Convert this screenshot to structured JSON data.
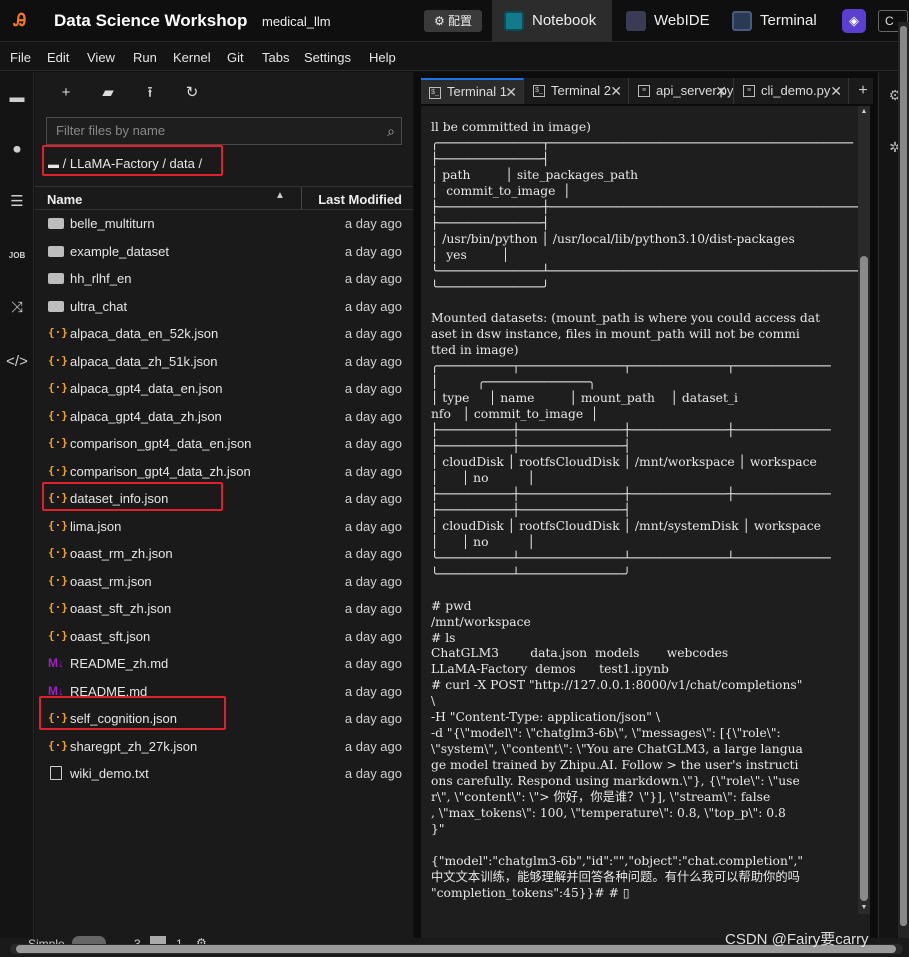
{
  "topbar": {
    "app_title": "Data Science Workshop",
    "project": "medical_llm",
    "config_label": "配置",
    "tabs": [
      {
        "label": "Notebook"
      },
      {
        "label": "WebIDE"
      },
      {
        "label": "Terminal"
      }
    ],
    "cut_label": "C"
  },
  "menu": [
    "File",
    "Edit",
    "View",
    "Run",
    "Kernel",
    "Git",
    "Tabs",
    "Settings",
    "Help"
  ],
  "filebrowser": {
    "filter_placeholder": "Filter files by name",
    "breadcrumb": "/ LLaMA-Factory / data /",
    "col_name": "Name",
    "col_modified": "Last Modified",
    "files": [
      {
        "name": "belle_multiturn",
        "type": "folder",
        "modified": "a day ago"
      },
      {
        "name": "example_dataset",
        "type": "folder",
        "modified": "a day ago"
      },
      {
        "name": "hh_rlhf_en",
        "type": "folder",
        "modified": "a day ago"
      },
      {
        "name": "ultra_chat",
        "type": "folder",
        "modified": "a day ago"
      },
      {
        "name": "alpaca_data_en_52k.json",
        "type": "json",
        "modified": "a day ago"
      },
      {
        "name": "alpaca_data_zh_51k.json",
        "type": "json",
        "modified": "a day ago"
      },
      {
        "name": "alpaca_gpt4_data_en.json",
        "type": "json",
        "modified": "a day ago"
      },
      {
        "name": "alpaca_gpt4_data_zh.json",
        "type": "json",
        "modified": "a day ago"
      },
      {
        "name": "comparison_gpt4_data_en.json",
        "type": "json",
        "modified": "a day ago"
      },
      {
        "name": "comparison_gpt4_data_zh.json",
        "type": "json",
        "modified": "a day ago"
      },
      {
        "name": "dataset_info.json",
        "type": "json",
        "modified": "a day ago"
      },
      {
        "name": "lima.json",
        "type": "json",
        "modified": "a day ago"
      },
      {
        "name": "oaast_rm_zh.json",
        "type": "json",
        "modified": "a day ago"
      },
      {
        "name": "oaast_rm.json",
        "type": "json",
        "modified": "a day ago"
      },
      {
        "name": "oaast_sft_zh.json",
        "type": "json",
        "modified": "a day ago"
      },
      {
        "name": "oaast_sft.json",
        "type": "json",
        "modified": "a day ago"
      },
      {
        "name": "README_zh.md",
        "type": "md",
        "modified": "a day ago"
      },
      {
        "name": "README.md",
        "type": "md",
        "modified": "a day ago"
      },
      {
        "name": "self_cognition.json",
        "type": "json",
        "modified": "a day ago"
      },
      {
        "name": "sharegpt_zh_27k.json",
        "type": "json",
        "modified": "a day ago"
      },
      {
        "name": "wiki_demo.txt",
        "type": "txt",
        "modified": "a day ago"
      }
    ]
  },
  "worktabs": [
    {
      "label": "Terminal 1",
      "active": true
    },
    {
      "label": "Terminal 2",
      "active": false
    },
    {
      "label": "api_server.py",
      "active": false
    },
    {
      "label": "cli_demo.py",
      "active": false
    }
  ],
  "terminal_text": "ll be committed in image)\n╭──────────────┬─────────────────────────────────────────\n├──────────────┤\n│ path         │ site_packages_path\n│  commit_to_image  │\n├──────────────┼──────────────────────────────────────────\n├──────────────┤\n│ /usr/bin/python │ /usr/local/lib/python3.10/dist-packages\n│  yes         │\n╰──────────────┴──────────────────────────────────────────\n╰──────────────╯\n\nMounted datasets: (mount_path is where you could access dat\naset in dsw instance, files in mount_path will not be commi\ntted in image)\n╭──────────┬──────────────┬─────────────┬─────────────\n│          ╭──────────────╮\n│ type     │ name         │ mount_path    │ dataset_i\nnfo   │ commit_to_image  │\n├──────────┼──────────────┼─────────────┼─────────────\n├──────────┼──────────────┤\n│ cloudDisk │ rootfsCloudDisk │ /mnt/workspace │ workspace\n│      │ no          │\n├──────────┼──────────────┼─────────────┼─────────────\n├──────────┼──────────────┤\n│ cloudDisk │ rootfsCloudDisk │ /mnt/systemDisk │ workspace\n│      │ no          │\n╰──────────┴──────────────┴─────────────┴─────────────\n╰──────────┴──────────────╯\n\n# pwd\n/mnt/workspace\n# ls\nChatGLM3        data.json  models       webcodes\nLLaMA-Factory  demos      test1.ipynb\n# curl -X POST \"http://127.0.0.1:8000/v1/chat/completions\"\n\\\n-H \"Content-Type: application/json\" \\\n-d \"{\\\"model\\\": \\\"chatglm3-6b\\\", \\\"messages\\\": [{\\\"role\\\":\n\\\"system\\\", \\\"content\\\": \\\"You are ChatGLM3, a large langua\nge model trained by Zhipu.AI. Follow > the user's instructi\nons carefully. Respond using markdown.\\\"}, {\\\"role\\\": \\\"use\nr\\\", \\\"content\\\": \\\"> 你好，你是谁？\\\"}], \\\"stream\\\": false\n, \\\"max_tokens\\\": 100, \\\"temperature\\\": 0.8, \\\"top_p\\\": 0.8\n}\"\n\n{\"model\":\"chatglm3-6b\",\"id\":\"\",\"object\":\"chat.completion\",\"\n中文文本训练，能够理解并回答各种问题。有什么我可以帮助你的吗\n\"completion_tokens\":45}}# # ▯",
  "statusbar": {
    "mode": "Simple",
    "num_a": "3",
    "num_b": "1"
  },
  "watermark": "CSDN @Fairy要carry"
}
